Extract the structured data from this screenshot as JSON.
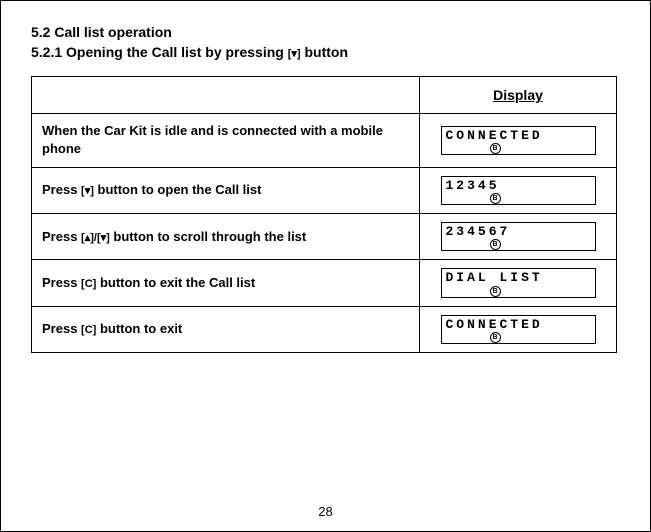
{
  "headings": {
    "h1": "5.2  Call list operation",
    "h2_prefix": "5.2.1  Opening the Call list by pressing ",
    "h2_btn": "[▾]",
    "h2_suffix": " button"
  },
  "table": {
    "display_header": "Display",
    "rows": [
      {
        "instr_pre": "When the Car Kit is idle and is connected with a mobile phone",
        "instr_btn": "",
        "instr_post": "",
        "display": "CONNECTED"
      },
      {
        "instr_pre": "Press ",
        "instr_btn": "[▾]",
        "instr_post": " button to open the Call list",
        "display": "12345"
      },
      {
        "instr_pre": "Press ",
        "instr_btn": "[▴]/[▾]",
        "instr_post": " button to scroll through the list",
        "display": "234567"
      },
      {
        "instr_pre": "Press ",
        "instr_btn": "[C]",
        "instr_post": " button to exit the Call list",
        "display": "DIAL  LIST"
      },
      {
        "instr_pre": "Press ",
        "instr_btn": "[C]",
        "instr_post": " button to exit",
        "display": "CONNECTED"
      }
    ]
  },
  "page_number": "28"
}
